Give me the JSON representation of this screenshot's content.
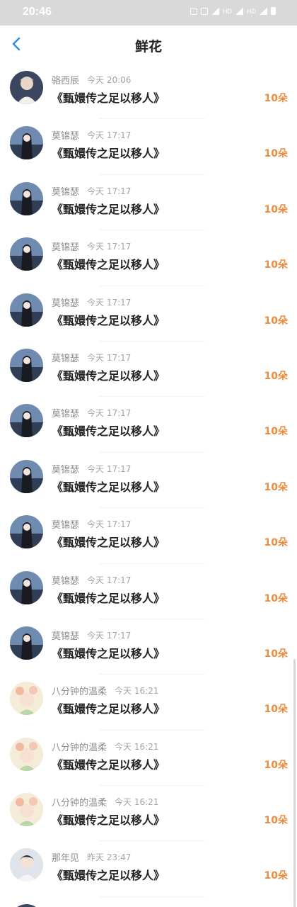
{
  "status_bar": {
    "time": "20:46",
    "net1": "HD",
    "net2": "HD",
    "sig1": "4G",
    "sig2": "4G"
  },
  "nav": {
    "title": "鲜花"
  },
  "colors": {
    "accent_blue": "#2a8bf2",
    "count_orange": "#f08a3b"
  },
  "items": [
    {
      "name": "骆西辰",
      "time": "今天 20:06",
      "book": "《甄嬛传之足以移人》",
      "count": "10朵",
      "avatar": "boy-icon"
    },
    {
      "name": "莫锦瑟",
      "time": "今天 17:17",
      "book": "《甄嬛传之足以移人》",
      "count": "10朵",
      "avatar": "girl-icon"
    },
    {
      "name": "莫锦瑟",
      "time": "今天 17:17",
      "book": "《甄嬛传之足以移人》",
      "count": "10朵",
      "avatar": "girl-icon"
    },
    {
      "name": "莫锦瑟",
      "time": "今天 17:17",
      "book": "《甄嬛传之足以移人》",
      "count": "10朵",
      "avatar": "girl-icon"
    },
    {
      "name": "莫锦瑟",
      "time": "今天 17:17",
      "book": "《甄嬛传之足以移人》",
      "count": "10朵",
      "avatar": "girl-icon"
    },
    {
      "name": "莫锦瑟",
      "time": "今天 17:17",
      "book": "《甄嬛传之足以移人》",
      "count": "10朵",
      "avatar": "girl-icon"
    },
    {
      "name": "莫锦瑟",
      "time": "今天 17:17",
      "book": "《甄嬛传之足以移人》",
      "count": "10朵",
      "avatar": "girl-icon"
    },
    {
      "name": "莫锦瑟",
      "time": "今天 17:17",
      "book": "《甄嬛传之足以移人》",
      "count": "10朵",
      "avatar": "girl-icon"
    },
    {
      "name": "莫锦瑟",
      "time": "今天 17:17",
      "book": "《甄嬛传之足以移人》",
      "count": "10朵",
      "avatar": "girl-icon"
    },
    {
      "name": "莫锦瑟",
      "time": "今天 17:17",
      "book": "《甄嬛传之足以移人》",
      "count": "10朵",
      "avatar": "girl-icon"
    },
    {
      "name": "莫锦瑟",
      "time": "今天 17:17",
      "book": "《甄嬛传之足以移人》",
      "count": "10朵",
      "avatar": "girl-icon"
    },
    {
      "name": "八分钟的温柔",
      "time": "今天 16:21",
      "book": "《甄嬛传之足以移人》",
      "count": "10朵",
      "avatar": "flower-girl-icon"
    },
    {
      "name": "八分钟的温柔",
      "time": "今天 16:21",
      "book": "《甄嬛传之足以移人》",
      "count": "10朵",
      "avatar": "flower-girl-icon"
    },
    {
      "name": "八分钟的温柔",
      "time": "今天 16:21",
      "book": "《甄嬛传之足以移人》",
      "count": "10朵",
      "avatar": "flower-girl-icon"
    },
    {
      "name": "那年见",
      "time": "昨天 23:47",
      "book": "《甄嬛传之足以移人》",
      "count": "10朵",
      "avatar": "man-icon"
    },
    {
      "name": "",
      "time": "",
      "book": "",
      "count": "",
      "avatar": "boy-icon"
    }
  ]
}
